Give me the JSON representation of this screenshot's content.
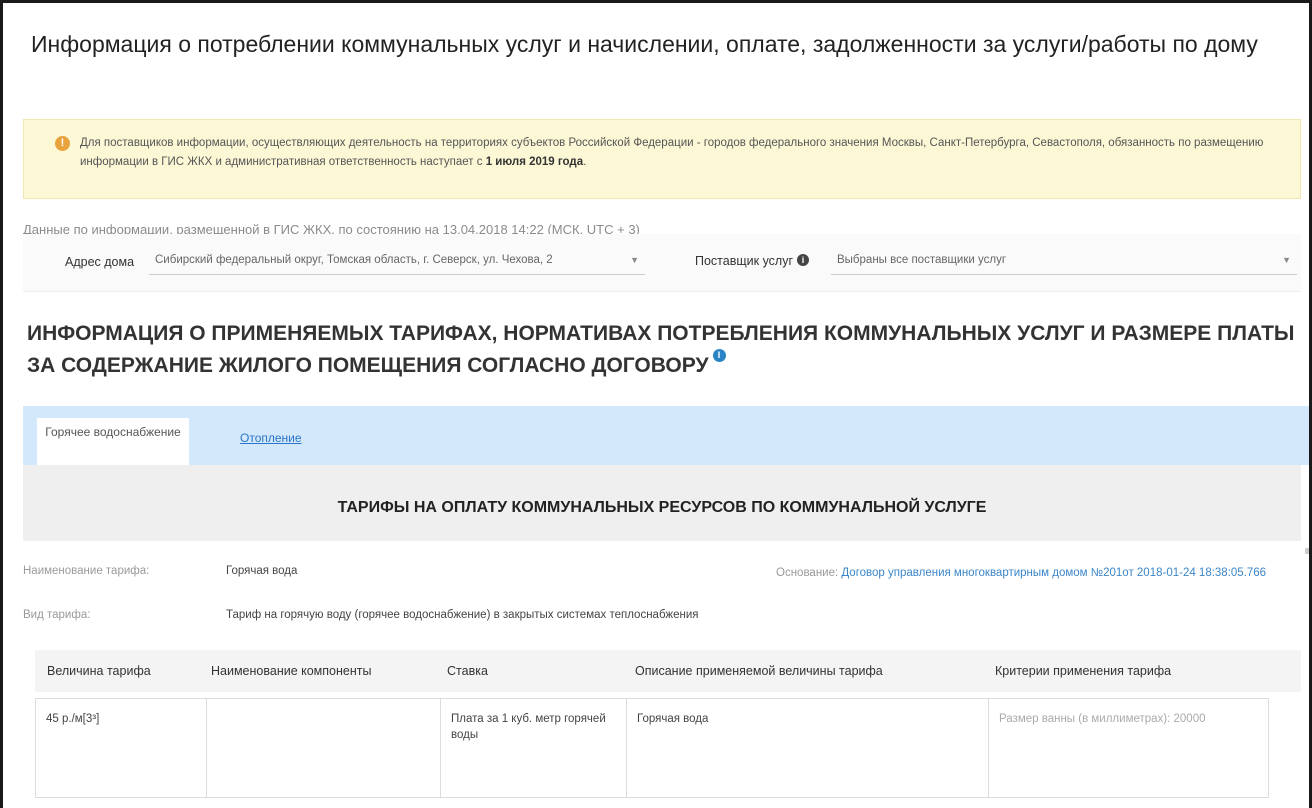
{
  "page_title": "Информация о потреблении коммунальных услуг и начислении, оплате, задолженности за услуги/работы по дому",
  "notice": {
    "icon": "warning-circle-icon",
    "text_part1": "Для поставщиков информации, осуществляющих деятельность на территориях субъектов Российской Федерации - городов федерального значения Москвы, Санкт-Петербурга, Севастополя, обязанность по размещению информации в ГИС ЖКХ и административная ответственность наступает с ",
    "text_bold": "1 июля 2019 года",
    "text_part2": "."
  },
  "data_info": "Данные по информации, размещенной в ГИС ЖКХ, по состоянию на 13.04.2018 14:22 (МСК, UTC + 3)",
  "filters": {
    "address_label": "Адрес дома",
    "address_value": "Сибирский федеральный округ, Томская область, г. Северск, ул. Чехова, 2",
    "supplier_label": "Поставщик услуг",
    "supplier_value": "Выбраны все поставщики услуг"
  },
  "section_title": "ИНФОРМАЦИЯ О ПРИМЕНЯЕМЫХ ТАРИФАХ, НОРМАТИВАХ ПОТРЕБЛЕНИЯ КОММУНАЛЬНЫХ УСЛУГ И РАЗМЕРЕ ПЛАТЫ ЗА СОДЕРЖАНИЕ ЖИЛОГО ПОМЕЩЕНИЯ СОГЛАСНО ДОГОВОРУ",
  "tabs": {
    "active": "Горячее водоснабжение",
    "other": "Отопление"
  },
  "tariff": {
    "heading": "ТАРИФЫ НА ОПЛАТУ КОММУНАЛЬНЫХ РЕСУРСОВ ПО КОММУНАЛЬНОЙ УСЛУГЕ",
    "name_label": "Наименование тарифа:",
    "name_value": "Горячая вода",
    "basis_label": "Основание:",
    "basis_value": "Договор управления многоквартирным домом №201от 2018-01-24 18:38:05.766",
    "type_label": "Вид тарифа:",
    "type_value": "Тариф на горячую воду (горячее водоснабжение) в закрытых системах теплоснабжения"
  },
  "table": {
    "headers": [
      "Величина тарифа",
      "Наименование компоненты",
      "Ставка",
      "Описание применяемой величины тарифа",
      "Критерии применения тарифа"
    ],
    "rows": [
      [
        "45 р./м[3³]",
        "",
        "Плата за 1 куб. метр горячей воды",
        "Горячая вода",
        "Размер ванны (в миллиметрах): 20000"
      ]
    ]
  },
  "colors": {
    "notice_bg": "#fcf8d6",
    "tabs_bg": "#d3e8fa",
    "link": "#2a75c8",
    "accent_dark_red": "#7a2e3a"
  }
}
